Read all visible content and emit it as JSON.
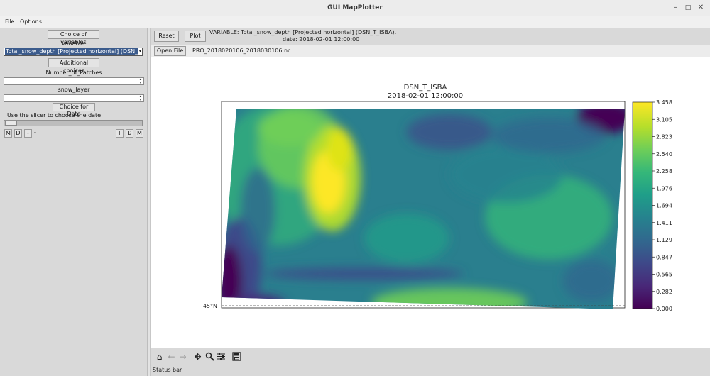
{
  "window": {
    "title": "GUI MapPlotter"
  },
  "menu": {
    "file": "File",
    "options": "Options"
  },
  "left_panel": {
    "choice_of_variables": "Choice of variables",
    "variable_label": "Variable:",
    "variable_selected": "Total_snow_depth [Projected horizontal] (DSN_T_",
    "additional_choices": "Additional choices",
    "number_of_patches_label": "Number_of_Patches",
    "number_of_patches_value": "",
    "snow_layer_label": "snow_layer",
    "snow_layer_value": "",
    "choice_for_date": "Choice for Date",
    "slicer_hint": "Use the slicer to choose the date",
    "date_buttons": {
      "m_minus": "M",
      "d_minus": "D",
      "minus": "-",
      "dash": "-",
      "plus": "+",
      "d_plus": "D",
      "m_plus": "M"
    }
  },
  "toolbar": {
    "reset": "Reset",
    "plot": "Plot",
    "variable_info_line1": "VARIABLE: Total_snow_depth [Projected horizontal] (DSN_T_ISBA).",
    "variable_info_line2": "date: 2018-02-01 12:00:00",
    "open_file": "Open File",
    "file_name": "PRO_2018020106_2018030106.nc"
  },
  "plot": {
    "title": "DSN_T_ISBA",
    "subtitle": "2018-02-01 12:00:00",
    "lat_label": "45°N",
    "colorbar_ticks": [
      "3.458",
      "3.105",
      "2.823",
      "2.540",
      "2.258",
      "1.976",
      "1.694",
      "1.411",
      "1.129",
      "0.847",
      "0.565",
      "0.282",
      "0.000"
    ],
    "colormap": [
      "#440154",
      "#482878",
      "#3e4989",
      "#31688e",
      "#26828e",
      "#1f9e89",
      "#35b779",
      "#6ece58",
      "#b5de2b",
      "#fde725"
    ]
  },
  "navbar": {
    "icons": [
      "home-icon",
      "back-icon",
      "forward-icon",
      "pan-icon",
      "zoom-icon",
      "configure-icon",
      "save-icon"
    ]
  },
  "status": {
    "text": "Status bar"
  }
}
